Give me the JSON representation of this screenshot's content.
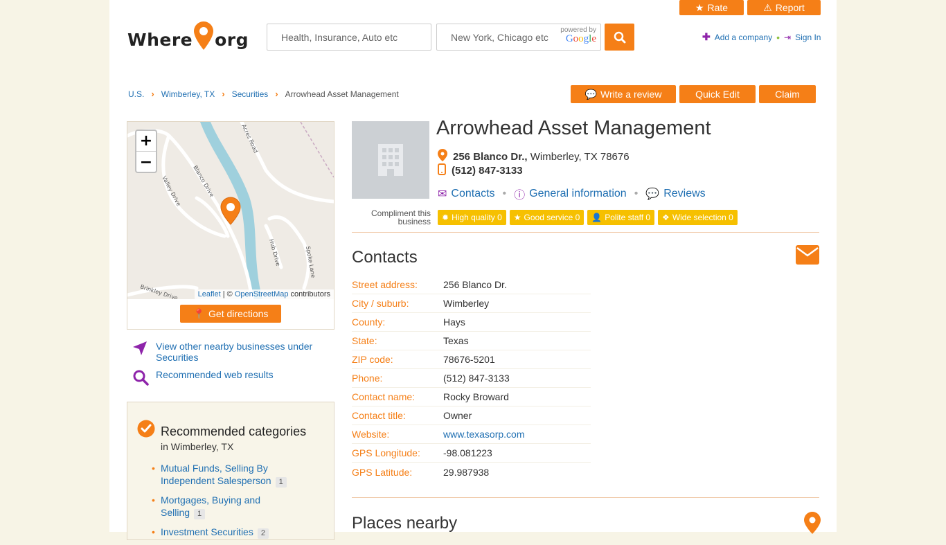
{
  "header": {
    "logo_text_left": "Where",
    "logo_text_right": "org",
    "search_placeholder": "Health, Insurance, Auto etc",
    "location_placeholder": "New York, Chicago etc",
    "powered_by": "powered by",
    "google": "Google",
    "rate_label": "Rate",
    "report_label": "Report",
    "add_company": "Add a company",
    "sign_in": "Sign In",
    "accent": "#f57f17"
  },
  "breadcrumb": [
    "U.S.",
    "Wimberley, TX",
    "Securities",
    "Arrowhead Asset Management"
  ],
  "actions": {
    "write_review": "Write a review",
    "quick_edit": "Quick Edit",
    "claim": "Claim"
  },
  "map": {
    "roads": [
      "Blanco Drive",
      "Valley Drive",
      "Acres Road",
      "Hub Drive",
      "Spoke Lane",
      "Brinkley Drive"
    ],
    "zoom_in": "+",
    "zoom_out": "−",
    "leaflet": "Leaflet",
    "attrib_sep": " | © ",
    "osm": "OpenStreetMap",
    "contributors": " contributors",
    "directions": "Get directions"
  },
  "side_links": {
    "nearby": "View other nearby businesses under Securities",
    "web": "Recommended web results"
  },
  "recommended": {
    "title": "Recommended categories",
    "subtitle": "in Wimberley, TX",
    "items": [
      {
        "label": "Mutual Funds, Selling By Independent Salesperson",
        "count": "1"
      },
      {
        "label": "Mortgages, Buying and Selling",
        "count": "1"
      },
      {
        "label": "Investment Securities",
        "count": "2"
      }
    ]
  },
  "business": {
    "name": "Arrowhead Asset Management",
    "street": "256 Blanco Dr.,",
    "city_line": "Wimberley, TX 78676",
    "phone": "(512) 847-3133",
    "nav": {
      "contacts": "Contacts",
      "general": "General information",
      "reviews": "Reviews"
    },
    "compliment_label": "Compliment this business",
    "compliments": [
      "High quality 0",
      "Good service 0",
      "Polite staff 0",
      "Wide selection 0"
    ]
  },
  "contacts": {
    "title": "Contacts",
    "rows": [
      {
        "k": "Street address:",
        "v": "256 Blanco Dr."
      },
      {
        "k": "City / suburb:",
        "v": "Wimberley"
      },
      {
        "k": "County:",
        "v": "Hays"
      },
      {
        "k": "State:",
        "v": "Texas"
      },
      {
        "k": "ZIP code:",
        "v": "78676-5201"
      },
      {
        "k": "Phone:",
        "v": "(512) 847-3133"
      },
      {
        "k": "Contact name:",
        "v": "Rocky Broward"
      },
      {
        "k": "Contact title:",
        "v": "Owner"
      },
      {
        "k": "Website:",
        "v": "www.texasorp.com"
      },
      {
        "k": "GPS Longitude:",
        "v": "-98.081223"
      },
      {
        "k": "GPS Latitude:",
        "v": "29.987938"
      }
    ]
  },
  "places_nearby": {
    "title": "Places nearby"
  }
}
